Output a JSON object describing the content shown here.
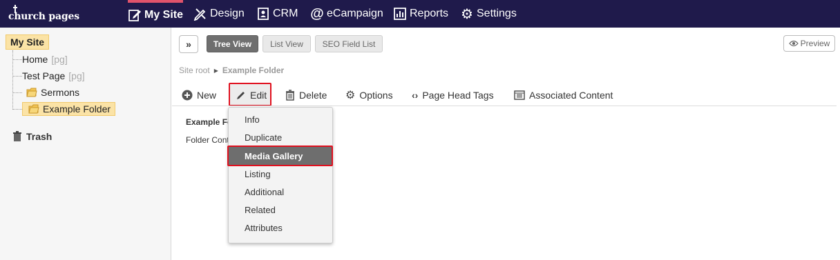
{
  "app": {
    "logo": "church pages"
  },
  "nav": {
    "items": [
      {
        "label": "My Site",
        "icon": "edit-page-icon"
      },
      {
        "label": "Design",
        "icon": "design-tools-icon"
      },
      {
        "label": "CRM",
        "icon": "contacts-icon"
      },
      {
        "label": "eCampaign",
        "icon": "at-sign-icon"
      },
      {
        "label": "Reports",
        "icon": "bar-chart-icon"
      },
      {
        "label": "Settings",
        "icon": "gear-icon"
      }
    ],
    "active": "My Site"
  },
  "sidebar": {
    "root": "My Site",
    "items": [
      {
        "label": "Home",
        "tag": "[pg]"
      },
      {
        "label": "Test Page",
        "tag": "[pg]"
      },
      {
        "label": "Sermons"
      },
      {
        "label": "Example Folder"
      }
    ],
    "trash": "Trash"
  },
  "views": {
    "tree": "Tree View",
    "list": "List View",
    "seo": "SEO Field List",
    "preview": "Preview"
  },
  "breadcrumb": {
    "root": "Site root",
    "current": "Example Folder"
  },
  "toolbar": {
    "new": "New",
    "edit": "Edit",
    "delete": "Delete",
    "options": "Options",
    "page_head_tags": "Page Head Tags",
    "associated_content": "Associated Content"
  },
  "content": {
    "title": "Example Fo",
    "subtitle": "Folder Cont"
  },
  "edit_menu": {
    "items": [
      "Info",
      "Duplicate",
      "Media Gallery",
      "Listing",
      "Additional",
      "Related",
      "Attributes"
    ],
    "active": "Media Gallery"
  },
  "colors": {
    "nav_bg": "#1f1a4b",
    "nav_active_accent": "#e0536b",
    "highlight": "#fbe3a6",
    "callout_red": "#e0101e"
  }
}
